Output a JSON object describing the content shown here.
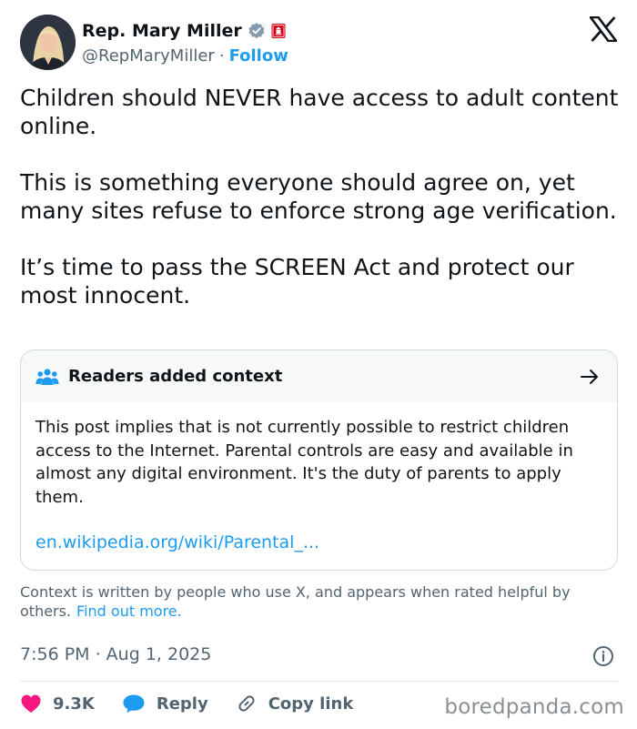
{
  "author": {
    "name": "Rep. Mary Miller",
    "handle": "@RepMaryMiller",
    "separator": "·",
    "follow_label": "Follow"
  },
  "tweet": {
    "text": "Children should NEVER have access to adult content online.\n\nThis is something everyone should agree on, yet many sites refuse to enforce strong age verification.\n\nIt’s time to pass the SCREEN Act and protect our most innocent."
  },
  "community_note": {
    "title": "Readers added context",
    "body": "This post implies that is not currently possible to restrict children access to the Internet. Parental controls are easy and available in almost any digital environment. It's the duty of parents to apply them.",
    "link": "en.wikipedia.org/wiki/Parental_..."
  },
  "context_footer": {
    "text": "Context is written by people who use X, and appears when rated helpful by others.",
    "find_out_more": "Find out more."
  },
  "timestamp": "7:56 PM · Aug 1, 2025",
  "actions": {
    "likes": "9.3K",
    "reply_label": "Reply",
    "copy_link_label": "Copy link"
  },
  "watermark": "boredpanda.com",
  "colors": {
    "accent": "#1d9bf0",
    "like": "#f91880",
    "muted": "#536471",
    "text": "#0f1419"
  },
  "icons": [
    "verified-badge-icon",
    "government-badge-icon",
    "x-logo-icon",
    "readers-context-icon",
    "arrow-right-icon",
    "info-icon",
    "heart-icon",
    "reply-bubble-icon",
    "link-icon"
  ]
}
